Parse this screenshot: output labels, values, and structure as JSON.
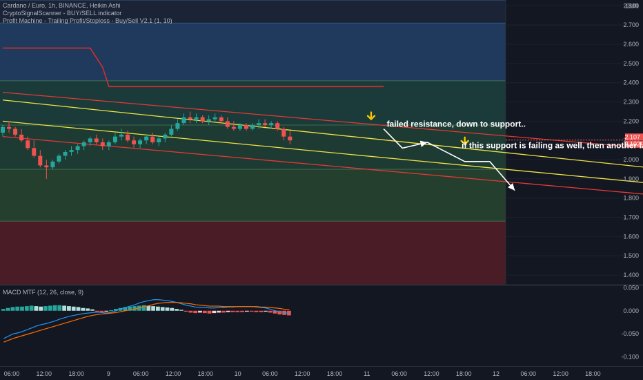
{
  "header": {
    "symbol_line": "Cardano / Euro, 1h, BINANCE, Heikin Ashi",
    "indicator_1": "CryptoSignalScanner - BUY/SELL indicator",
    "indicator_2": "Profit Machine - Trailing Profit/Stoploss - Buy/Sell V2.1 (1, 10)",
    "macd_label": "MACD MTF (12, 26, close, 9)"
  },
  "colors": {
    "background": "#131722",
    "bull": "#26a69a",
    "bear": "#ef5350",
    "channel_yellow": "#f0e442",
    "channel_red": "#e53935",
    "macd_line": "#2196f3",
    "signal_line": "#ff6d00",
    "zone_blue": "#1f3a5c",
    "zone_teal": "#1b3b3a",
    "zone_green": "#253f2e",
    "zone_red": "#4a1c25",
    "arrow_marker": "#f7c600"
  },
  "chart_data": [
    {
      "type": "candlestick",
      "title": "Cardano / Euro, 1h, BINANCE, Heikin Ashi",
      "y_unit": "EUR",
      "ylim": [
        1.35,
        2.83
      ],
      "y_ticks": [
        "2.800",
        "2.700",
        "2.600",
        "2.500",
        "2.400",
        "2.300",
        "2.200",
        "2.100",
        "2.000",
        "1.900",
        "1.800",
        "1.700",
        "1.600",
        "1.500",
        "1.400"
      ],
      "x_ticks": [
        "06:00",
        "12:00",
        "18:00",
        "9",
        "06:00",
        "12:00",
        "18:00",
        "10",
        "06:00",
        "12:00",
        "18:00",
        "11",
        "06:00",
        "12:00",
        "18:00",
        "12",
        "06:00",
        "12:00",
        "18:00"
      ],
      "price_labels": [
        {
          "text": "2.107",
          "value": 2.107,
          "color": "#ef5350"
        },
        {
          "text": "2.102",
          "value": 2.102,
          "color": "#ef5350"
        }
      ],
      "candles": [
        [
          2.14,
          2.18,
          2.12,
          2.17
        ],
        [
          2.17,
          2.2,
          2.14,
          2.16
        ],
        [
          2.16,
          2.17,
          2.12,
          2.13
        ],
        [
          2.13,
          2.16,
          2.09,
          2.1
        ],
        [
          2.1,
          2.12,
          2.05,
          2.06
        ],
        [
          2.06,
          2.1,
          2.01,
          2.02
        ],
        [
          2.02,
          2.05,
          1.96,
          1.97
        ],
        [
          1.97,
          2.0,
          1.9,
          1.96
        ],
        [
          1.96,
          2.0,
          1.95,
          1.99
        ],
        [
          1.99,
          2.03,
          1.98,
          2.02
        ],
        [
          2.02,
          2.05,
          2.0,
          2.04
        ],
        [
          2.04,
          2.07,
          2.02,
          2.05
        ],
        [
          2.05,
          2.08,
          2.03,
          2.07
        ],
        [
          2.07,
          2.1,
          2.05,
          2.09
        ],
        [
          2.09,
          2.12,
          2.07,
          2.11
        ],
        [
          2.11,
          2.13,
          2.08,
          2.09
        ],
        [
          2.09,
          2.11,
          2.05,
          2.07
        ],
        [
          2.07,
          2.1,
          2.05,
          2.09
        ],
        [
          2.09,
          2.14,
          2.08,
          2.12
        ],
        [
          2.12,
          2.16,
          2.1,
          2.13
        ],
        [
          2.13,
          2.15,
          2.09,
          2.1
        ],
        [
          2.1,
          2.12,
          2.06,
          2.08
        ],
        [
          2.08,
          2.11,
          2.06,
          2.1
        ],
        [
          2.1,
          2.13,
          2.08,
          2.12
        ],
        [
          2.12,
          2.14,
          2.08,
          2.09
        ],
        [
          2.09,
          2.12,
          2.07,
          2.11
        ],
        [
          2.11,
          2.14,
          2.09,
          2.13
        ],
        [
          2.13,
          2.18,
          2.12,
          2.16
        ],
        [
          2.16,
          2.21,
          2.15,
          2.19
        ],
        [
          2.19,
          2.24,
          2.18,
          2.22
        ],
        [
          2.22,
          2.25,
          2.19,
          2.21
        ],
        [
          2.21,
          2.24,
          2.19,
          2.22
        ],
        [
          2.22,
          2.23,
          2.19,
          2.2
        ],
        [
          2.2,
          2.23,
          2.18,
          2.21
        ],
        [
          2.21,
          2.24,
          2.2,
          2.22
        ],
        [
          2.22,
          2.23,
          2.19,
          2.2
        ],
        [
          2.2,
          2.22,
          2.16,
          2.17
        ],
        [
          2.17,
          2.2,
          2.15,
          2.16
        ],
        [
          2.16,
          2.19,
          2.15,
          2.18
        ],
        [
          2.18,
          2.19,
          2.15,
          2.16
        ],
        [
          2.16,
          2.19,
          2.15,
          2.18
        ],
        [
          2.18,
          2.21,
          2.16,
          2.19
        ],
        [
          2.19,
          2.21,
          2.17,
          2.18
        ],
        [
          2.18,
          2.2,
          2.16,
          2.19
        ],
        [
          2.19,
          2.2,
          2.15,
          2.16
        ],
        [
          2.16,
          2.17,
          2.1,
          2.12
        ],
        [
          2.12,
          2.15,
          2.08,
          2.1
        ]
      ],
      "channel_lines": [
        {
          "color": "#e53935",
          "from": [
            0,
            2.35
          ],
          "to": [
            103,
            2.06
          ]
        },
        {
          "color": "#f0e442",
          "from": [
            0,
            2.31
          ],
          "to": [
            103,
            1.96
          ]
        },
        {
          "color": "#f0e442",
          "from": [
            0,
            2.2
          ],
          "to": [
            103,
            1.88
          ]
        },
        {
          "color": "#e53935",
          "from": [
            0,
            2.12
          ],
          "to": [
            103,
            1.82
          ]
        }
      ],
      "zones": [
        {
          "from": 2.71,
          "to": 2.83,
          "color": "#1a2436"
        },
        {
          "from": 2.41,
          "to": 2.71,
          "color": "#1f3a5c"
        },
        {
          "from": 2.18,
          "to": 2.41,
          "color": "#1b3b3a"
        },
        {
          "from": 1.95,
          "to": 2.18,
          "color": "#1d3a33"
        },
        {
          "from": 1.68,
          "to": 1.95,
          "color": "#253f2e"
        },
        {
          "from": 1.35,
          "to": 1.68,
          "color": "#4a1c25"
        }
      ],
      "stop_line": [
        [
          0,
          2.58
        ],
        [
          14,
          2.58
        ],
        [
          16,
          2.48
        ],
        [
          17,
          2.38
        ],
        [
          61,
          2.38
        ]
      ],
      "annotations": [
        {
          "text": "failed resistance, down to support..",
          "x": 61.5,
          "y": 2.17
        },
        {
          "text": "if this support is failing as well, then another failed attempt to recover",
          "x": 73.5,
          "y": 2.06
        }
      ],
      "scenario_path": [
        [
          61,
          2.16
        ],
        [
          64,
          2.06
        ],
        [
          68,
          2.09
        ],
        [
          74,
          1.99
        ],
        [
          78,
          1.99
        ],
        [
          82,
          1.84
        ]
      ],
      "arrow_markers": [
        [
          59,
          2.21
        ],
        [
          74,
          2.08
        ]
      ]
    },
    {
      "type": "bar+line",
      "title": "MACD MTF (12, 26, close, 9)",
      "ylim": [
        -0.12,
        0.055
      ],
      "y_ticks": [
        "0.050",
        "0.000",
        "-0.050",
        "-0.100"
      ],
      "histogram": [
        0.004,
        0.006,
        0.008,
        0.009,
        0.009,
        0.01,
        0.011,
        0.01,
        0.009,
        0.01,
        0.011,
        0.012,
        0.012,
        0.011,
        0.01,
        0.009,
        0.008,
        0.006,
        0.005,
        0.003,
        -0.002,
        -0.003,
        -0.002,
        0.001,
        0.004,
        0.006,
        0.008,
        0.009,
        0.01,
        0.011,
        0.012,
        0.011,
        0.01,
        0.009,
        0.008,
        0.007,
        0.006,
        0.004,
        0.002,
        -0.002,
        -0.004,
        -0.005,
        -0.004,
        -0.005,
        -0.006,
        -0.005,
        -0.004,
        -0.004,
        -0.003,
        -0.003,
        -0.003,
        -0.003,
        -0.002,
        -0.002,
        -0.003,
        -0.003,
        -0.002,
        -0.004,
        -0.006,
        -0.008,
        -0.009,
        -0.01
      ],
      "macd_line": [
        -0.06,
        -0.055,
        -0.05,
        -0.048,
        -0.045,
        -0.041,
        -0.037,
        -0.033,
        -0.03,
        -0.028,
        -0.025,
        -0.022,
        -0.018,
        -0.015,
        -0.012,
        -0.01,
        -0.008,
        -0.006,
        -0.005,
        -0.004,
        -0.003,
        -0.004,
        -0.005,
        -0.003,
        0.0,
        0.004,
        0.007,
        0.01,
        0.013,
        0.017,
        0.02,
        0.022,
        0.024,
        0.024,
        0.023,
        0.022,
        0.02,
        0.018,
        0.015,
        0.012,
        0.01,
        0.008,
        0.007,
        0.007,
        0.006,
        0.006,
        0.007,
        0.007,
        0.008,
        0.008,
        0.009,
        0.009,
        0.009,
        0.009,
        0.008,
        0.007,
        0.006,
        0.003,
        0.0,
        -0.002,
        -0.004,
        -0.006
      ],
      "signal_line": [
        -0.068,
        -0.064,
        -0.06,
        -0.057,
        -0.054,
        -0.051,
        -0.048,
        -0.045,
        -0.042,
        -0.039,
        -0.036,
        -0.033,
        -0.03,
        -0.027,
        -0.024,
        -0.021,
        -0.018,
        -0.015,
        -0.012,
        -0.01,
        -0.008,
        -0.007,
        -0.006,
        -0.005,
        -0.004,
        -0.002,
        0.0,
        0.002,
        0.004,
        0.006,
        0.009,
        0.011,
        0.014,
        0.016,
        0.017,
        0.018,
        0.018,
        0.018,
        0.017,
        0.016,
        0.015,
        0.013,
        0.012,
        0.011,
        0.01,
        0.01,
        0.01,
        0.009,
        0.009,
        0.009,
        0.009,
        0.009,
        0.009,
        0.009,
        0.009,
        0.008,
        0.008,
        0.007,
        0.006,
        0.005,
        0.003,
        0.002
      ]
    }
  ]
}
